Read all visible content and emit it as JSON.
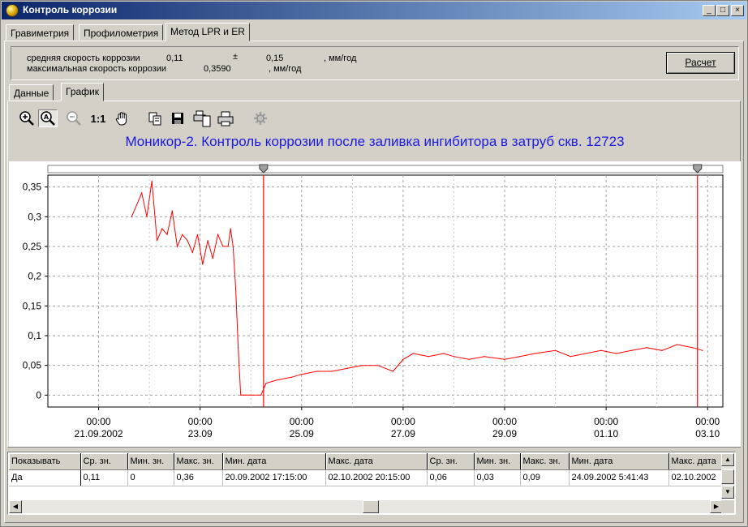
{
  "window": {
    "title": "Контроль коррозии",
    "min_btn": "_",
    "max_btn": "□",
    "close_btn": "×"
  },
  "main_tabs": [
    {
      "label": "Гравиметрия"
    },
    {
      "label": "Профилометрия"
    },
    {
      "label": "Метод LPR и ER",
      "active": true
    }
  ],
  "summary": {
    "avg_label": "средняя скорость коррозии",
    "avg_value": "0,11",
    "plus_minus": "±",
    "deviation": "0,15",
    "unit1": ", мм/год",
    "max_label": "максимальная скорость коррозии",
    "max_value": "0,3590",
    "unit2": ", мм/год",
    "calc_button": "Расчет"
  },
  "sub_tabs": [
    {
      "label": "Данные"
    },
    {
      "label": "График",
      "active": true
    }
  ],
  "toolbar": {
    "icons": [
      "zoom-in-icon",
      "zoom-area-icon",
      "zoom-out-icon",
      "zoom-reset-icon",
      "pan-hand-icon",
      "copy-icon",
      "save-icon",
      "print-preview-icon",
      "print-icon",
      "settings-icon"
    ],
    "reset_label": "1:1"
  },
  "chart_data": {
    "type": "line",
    "title": "Моникор-2. Контроль коррозии после заливка ингибитора в затруб скв. 12723",
    "x_ticks": [
      {
        "time": "00:00",
        "date": "21.09.2002"
      },
      {
        "time": "00:00",
        "date": "23.09"
      },
      {
        "time": "00:00",
        "date": "25.09"
      },
      {
        "time": "00:00",
        "date": "27.09"
      },
      {
        "time": "00:00",
        "date": "29.09"
      },
      {
        "time": "00:00",
        "date": "01.10"
      },
      {
        "time": "00:00",
        "date": "03.10"
      }
    ],
    "y_ticks": [
      "0,35",
      "0,3",
      "0,25",
      "0,2",
      "0,15",
      "0,1",
      "0,05",
      "0"
    ],
    "ylim": [
      -0.02,
      0.37
    ],
    "xlim_days": [
      -1.0,
      12.3
    ],
    "line_color": "#ff0000",
    "cursor_lines_days": [
      3.25,
      11.8
    ],
    "grid": true,
    "series": [
      {
        "x": [
          0.65,
          0.75,
          0.85,
          0.95,
          1.05,
          1.15,
          1.25,
          1.35,
          1.45,
          1.55,
          1.65,
          1.75,
          1.85,
          1.95,
          2.05,
          2.15,
          2.25,
          2.35,
          2.45,
          2.55,
          2.6,
          2.65,
          2.7,
          2.75,
          2.8,
          2.85,
          2.9,
          3.0,
          3.2,
          3.3,
          3.5,
          3.8,
          4.0,
          4.3,
          4.6,
          4.9,
          5.2,
          5.5,
          5.8,
          5.95,
          6.0,
          6.2,
          6.5,
          6.8,
          7.0,
          7.3,
          7.6,
          8.0,
          8.3,
          8.6,
          9.0,
          9.3,
          9.6,
          9.9,
          10.2,
          10.5,
          10.8,
          11.1,
          11.4,
          11.7,
          11.9
        ],
        "y": [
          0.3,
          0.32,
          0.34,
          0.3,
          0.36,
          0.26,
          0.28,
          0.27,
          0.31,
          0.25,
          0.27,
          0.26,
          0.24,
          0.27,
          0.22,
          0.26,
          0.23,
          0.27,
          0.25,
          0.25,
          0.28,
          0.25,
          0.18,
          0.08,
          0.0,
          0.0,
          0.0,
          0.0,
          0.0,
          0.02,
          0.025,
          0.03,
          0.035,
          0.04,
          0.04,
          0.045,
          0.05,
          0.05,
          0.04,
          0.055,
          0.06,
          0.07,
          0.065,
          0.07,
          0.065,
          0.06,
          0.065,
          0.06,
          0.065,
          0.07,
          0.075,
          0.065,
          0.07,
          0.075,
          0.07,
          0.075,
          0.08,
          0.075,
          0.085,
          0.08,
          0.075
        ]
      }
    ]
  },
  "table": {
    "headers": [
      "Показывать",
      "Ср. зн.",
      "Мин. зн.",
      "Макс. зн.",
      "Мин. дата",
      "Макс. дата",
      "Ср. зн.",
      "Мин. зн.",
      "Макс. зн.",
      "Мин. дата",
      "Макс. дата"
    ],
    "rows": [
      [
        "Да",
        "0,11",
        "0",
        "0,36",
        "20.09.2002 17:15:00",
        "02.10.2002 20:15:00",
        "0,06",
        "0,03",
        "0,09",
        "24.09.2002 5:41:43",
        "02.10.2002"
      ]
    ]
  }
}
